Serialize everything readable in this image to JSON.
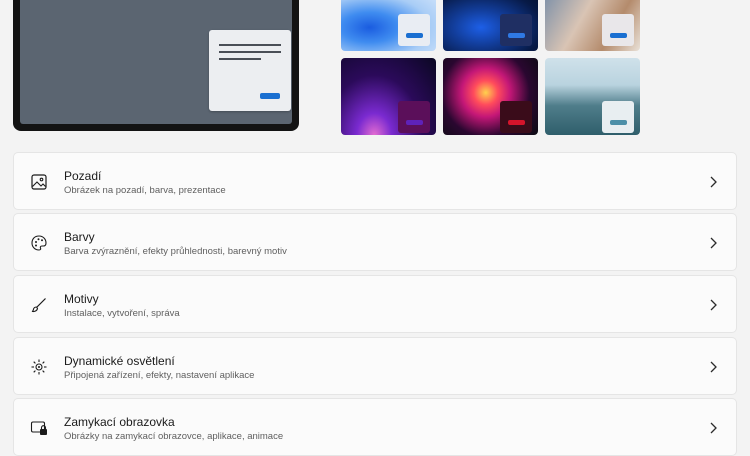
{
  "cards": [
    {
      "id": "background",
      "title": "Pozadí",
      "subtitle": "Obrázek na pozadí, barva, prezentace",
      "icon": "image-icon"
    },
    {
      "id": "colors",
      "title": "Barvy",
      "subtitle": "Barva zvýraznění, efekty průhlednosti, barevný motiv",
      "icon": "palette-icon"
    },
    {
      "id": "themes",
      "title": "Motivy",
      "subtitle": "Instalace, vytvoření, správa",
      "icon": "brush-icon"
    },
    {
      "id": "dynamic-lighting",
      "title": "Dynamické osvětlení",
      "subtitle": "Připojená zařízení, efekty, nastavení aplikace",
      "icon": "lighting-icon"
    },
    {
      "id": "lock-screen",
      "title": "Zamykací obrazovka",
      "subtitle": "Obrázky na zamykací obrazovce, aplikace, animace",
      "icon": "lock-screen-icon"
    }
  ],
  "theme_thumbnails": [
    {
      "name": "windows-light-bloom",
      "accent": "#1a6fd1"
    },
    {
      "name": "windows-dark-bloom",
      "accent": "#2f79e4"
    },
    {
      "name": "glow-flowers",
      "accent": "#1a6fd1"
    },
    {
      "name": "captured-motion",
      "accent": "#5e22b9"
    },
    {
      "name": "flow",
      "accent": "#d4142b"
    },
    {
      "name": "sunrise-lake",
      "accent": "#4c8fa8"
    }
  ]
}
